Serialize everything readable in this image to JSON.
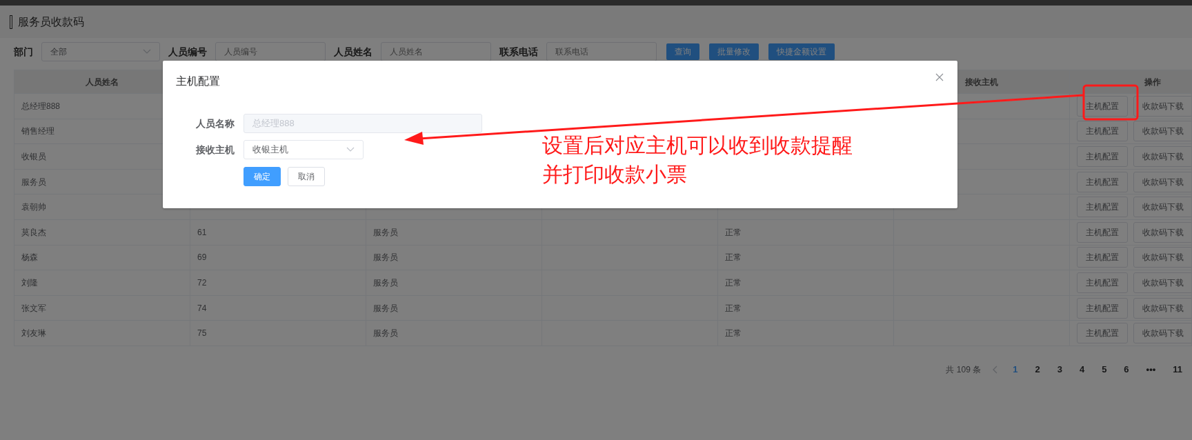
{
  "page": {
    "title": "服务员收款码"
  },
  "filters": [
    {
      "kind": "select",
      "label": "部门",
      "value": "全部"
    },
    {
      "kind": "input",
      "label": "人员编号",
      "placeholder": "人员编号"
    },
    {
      "kind": "input",
      "label": "人员姓名",
      "placeholder": "人员姓名"
    },
    {
      "kind": "input",
      "label": "联系电话",
      "placeholder": "联系电话"
    }
  ],
  "toolbar_buttons": [
    "查询",
    "批量修改",
    "快捷金额设置"
  ],
  "table": {
    "columns": [
      "人员姓名",
      null,
      null,
      null,
      null,
      "接收主机",
      "操作"
    ],
    "rows": [
      {
        "name": "总经理888",
        "actions": [
          "主机配置",
          "收款码下载"
        ]
      },
      {
        "name": "销售经理",
        "actions": [
          "主机配置",
          "收款码下载"
        ]
      },
      {
        "name": "收银员",
        "actions": [
          "主机配置",
          "收款码下载"
        ]
      },
      {
        "name": "服务员",
        "actions": [
          "主机配置",
          "收款码下载"
        ]
      },
      {
        "name": "袁朝帅",
        "actions": [
          "主机配置",
          "收款码下载"
        ]
      },
      {
        "name": "莫良杰",
        "column_2": "61",
        "column_3": "服务员",
        "column_5": "正常",
        "actions": [
          "主机配置",
          "收款码下载"
        ]
      },
      {
        "name": "杨森",
        "column_2": "69",
        "column_3": "服务员",
        "column_5": "正常",
        "actions": [
          "主机配置",
          "收款码下载"
        ]
      },
      {
        "name": "刘隆",
        "column_2": "72",
        "column_3": "服务员",
        "column_5": "正常",
        "actions": [
          "主机配置",
          "收款码下载"
        ]
      },
      {
        "name": "张文军",
        "column_2": "74",
        "column_3": "服务员",
        "column_5": "正常",
        "actions": [
          "主机配置",
          "收款码下载"
        ]
      },
      {
        "name": "刘友琳",
        "column_2": "75",
        "column_3": "服务员",
        "column_5": "正常",
        "actions": [
          "主机配置",
          "收款码下载"
        ]
      }
    ]
  },
  "pagination": {
    "total": "共 109 条",
    "pages": [
      {
        "label": "1",
        "selected": true
      },
      {
        "label": "2",
        "selected": false
      },
      {
        "label": "3",
        "selected": false
      },
      {
        "label": "4",
        "selected": false
      },
      {
        "label": "5",
        "selected": false
      },
      {
        "label": "6",
        "selected": false
      },
      {
        "label": "•••",
        "selected": false
      },
      {
        "label": "11",
        "selected": false
      }
    ]
  },
  "dialog": {
    "title": "主机配置",
    "fields": [
      {
        "kind": "input",
        "label": "人员名称",
        "value": "总经理888",
        "disabled": true
      },
      {
        "kind": "select",
        "label": "接收主机",
        "value": "收银主机",
        "disabled": false
      }
    ],
    "buttons": [
      {
        "label": "确定",
        "kind": "primary"
      },
      {
        "label": "取消",
        "kind": "default"
      }
    ]
  },
  "annotation": {
    "lines": [
      "设置后对应主机可以收到收款提醒",
      "并打印收款小票"
    ]
  }
}
